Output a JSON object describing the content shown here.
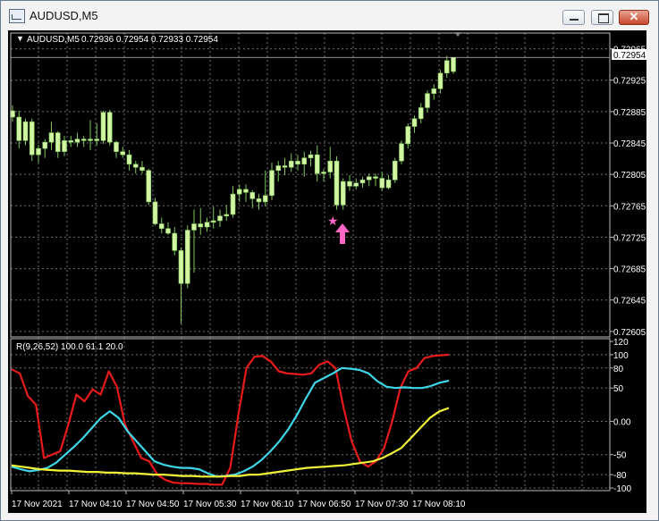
{
  "window": {
    "title": "AUDUSD,M5",
    "icon": "chart-window-icon",
    "buttons": {
      "minimize": "minimize-icon",
      "maximize": "maximize-icon",
      "close": "close-icon",
      "close_glyph": "✕"
    }
  },
  "chart_header": {
    "arrow": "▼",
    "symbol": "AUDUSD,M5",
    "ohlc": "0.72936 0.72954 0.72933 0.72954"
  },
  "price_axis": {
    "ticks": [
      "0.72965",
      "0.72925",
      "0.72885",
      "0.72845",
      "0.72805",
      "0.72765",
      "0.72725",
      "0.72685",
      "0.72645",
      "0.72605"
    ],
    "current_price": "0.72954"
  },
  "indicator": {
    "label": "R(9,26,52) 100.0 61.1 20.0",
    "ticks": [
      "120",
      "100",
      "80",
      "50",
      "0.00",
      "-50",
      "-80",
      "-100"
    ]
  },
  "time_axis": {
    "ticks": [
      "17 Nov 2021",
      "17 Nov 04:10",
      "17 Nov 04:50",
      "17 Nov 05:30",
      "17 Nov 06:10",
      "17 Nov 06:50",
      "17 Nov 07:30",
      "17 Nov 08:10"
    ]
  },
  "signal": {
    "star": "★",
    "arrow": "up-arrow-signal-icon"
  },
  "colors": {
    "background": "#000000",
    "grid": "#6f6f6f",
    "candle_body": "#d2f5a4",
    "candle_wick": "#7fc65a",
    "price_line": "#c0c0c0",
    "signal": "#ff66c4",
    "line_red": "#e81a1a",
    "line_cyan": "#3fd6e8",
    "line_yellow": "#f2f23a",
    "text": "#ffffff"
  },
  "chart_data": [
    {
      "type": "candlestick",
      "symbol": "AUDUSD,M5",
      "ylim": [
        0.72598,
        0.72985
      ],
      "candles": [
        [
          0.72886,
          0.72893,
          0.72872,
          0.72878
        ],
        [
          0.72878,
          0.72886,
          0.72838,
          0.72848
        ],
        [
          0.72848,
          0.72876,
          0.72842,
          0.72872
        ],
        [
          0.72872,
          0.72876,
          0.72822,
          0.7283
        ],
        [
          0.7283,
          0.72842,
          0.7282,
          0.72838
        ],
        [
          0.72838,
          0.7285,
          0.72826,
          0.72846
        ],
        [
          0.72846,
          0.72872,
          0.72836,
          0.72858
        ],
        [
          0.72858,
          0.7286,
          0.72826,
          0.72834
        ],
        [
          0.72834,
          0.72854,
          0.72828,
          0.72848
        ],
        [
          0.72848,
          0.72854,
          0.7284,
          0.72846
        ],
        [
          0.72846,
          0.72858,
          0.7284,
          0.7285
        ],
        [
          0.7285,
          0.72854,
          0.7284,
          0.72848
        ],
        [
          0.72848,
          0.72874,
          0.72836,
          0.7285
        ],
        [
          0.7285,
          0.7287,
          0.72842,
          0.72848
        ],
        [
          0.72848,
          0.72886,
          0.72844,
          0.72884
        ],
        [
          0.72884,
          0.72887,
          0.72842,
          0.72846
        ],
        [
          0.72846,
          0.72848,
          0.72826,
          0.72834
        ],
        [
          0.72834,
          0.7284,
          0.72826,
          0.7283
        ],
        [
          0.7283,
          0.72836,
          0.7281,
          0.72818
        ],
        [
          0.72818,
          0.72822,
          0.72806,
          0.72814
        ],
        [
          0.72814,
          0.72822,
          0.72806,
          0.7281
        ],
        [
          0.7281,
          0.72812,
          0.72766,
          0.7277
        ],
        [
          0.7277,
          0.72775,
          0.7274,
          0.72742
        ],
        [
          0.72742,
          0.7275,
          0.7273,
          0.72736
        ],
        [
          0.72736,
          0.72744,
          0.72728,
          0.7273
        ],
        [
          0.7273,
          0.72738,
          0.72702,
          0.72708
        ],
        [
          0.72708,
          0.72712,
          0.72615,
          0.72666
        ],
        [
          0.72666,
          0.7274,
          0.7266,
          0.72734
        ],
        [
          0.72734,
          0.7276,
          0.7268,
          0.72742
        ],
        [
          0.72742,
          0.72762,
          0.72728,
          0.72738
        ],
        [
          0.72738,
          0.7275,
          0.72732,
          0.72744
        ],
        [
          0.72744,
          0.72764,
          0.72736,
          0.72746
        ],
        [
          0.72746,
          0.7276,
          0.72738,
          0.72752
        ],
        [
          0.72752,
          0.72766,
          0.72746,
          0.72754
        ],
        [
          0.72754,
          0.7279,
          0.7275,
          0.7278
        ],
        [
          0.7278,
          0.72792,
          0.7277,
          0.72786
        ],
        [
          0.72786,
          0.72792,
          0.7277,
          0.72782
        ],
        [
          0.72782,
          0.72785,
          0.72762,
          0.72774
        ],
        [
          0.72774,
          0.7278,
          0.7276,
          0.7277
        ],
        [
          0.7277,
          0.7281,
          0.72764,
          0.72778
        ],
        [
          0.72778,
          0.7282,
          0.72772,
          0.7281
        ],
        [
          0.7281,
          0.72822,
          0.72796,
          0.72816
        ],
        [
          0.72816,
          0.72826,
          0.72804,
          0.72814
        ],
        [
          0.72814,
          0.72832,
          0.72808,
          0.72822
        ],
        [
          0.72822,
          0.7283,
          0.7281,
          0.72818
        ],
        [
          0.72818,
          0.72834,
          0.72802,
          0.72826
        ],
        [
          0.72826,
          0.72835,
          0.72815,
          0.7283
        ],
        [
          0.7283,
          0.72842,
          0.72796,
          0.72806
        ],
        [
          0.72806,
          0.72812,
          0.72796,
          0.72808
        ],
        [
          0.72808,
          0.7284,
          0.728,
          0.72822
        ],
        [
          0.72822,
          0.72828,
          0.7276,
          0.72766
        ],
        [
          0.72766,
          0.728,
          0.7276,
          0.72796
        ],
        [
          0.72796,
          0.72804,
          0.72784,
          0.7279
        ],
        [
          0.7279,
          0.728,
          0.72786,
          0.72794
        ],
        [
          0.72794,
          0.72802,
          0.72788,
          0.72798
        ],
        [
          0.72798,
          0.72806,
          0.7279,
          0.72802
        ],
        [
          0.72802,
          0.72806,
          0.7279,
          0.728
        ],
        [
          0.728,
          0.72808,
          0.72784,
          0.72788
        ],
        [
          0.72788,
          0.72804,
          0.72786,
          0.72798
        ],
        [
          0.72798,
          0.72826,
          0.72794,
          0.72822
        ],
        [
          0.72822,
          0.72848,
          0.72818,
          0.72844
        ],
        [
          0.72844,
          0.7287,
          0.72838,
          0.72866
        ],
        [
          0.72866,
          0.7288,
          0.72858,
          0.72876
        ],
        [
          0.72876,
          0.72896,
          0.7287,
          0.7289
        ],
        [
          0.7289,
          0.72912,
          0.72884,
          0.72908
        ],
        [
          0.72908,
          0.7292,
          0.729,
          0.72914
        ],
        [
          0.72914,
          0.72938,
          0.72908,
          0.72934
        ],
        [
          0.72934,
          0.72956,
          0.72928,
          0.7295
        ],
        [
          0.72936,
          0.72954,
          0.72933,
          0.72954
        ]
      ]
    },
    {
      "type": "line",
      "title": "R(9,26,52) 100.0 61.1 20.0",
      "ylim": [
        -104,
        124
      ],
      "series_count": 3,
      "x": [
        0,
        2,
        4,
        6,
        8,
        10,
        12,
        14,
        16,
        18,
        20,
        22,
        24,
        26,
        28,
        30,
        32,
        34,
        36,
        38,
        40,
        42,
        44,
        46,
        48,
        50,
        52,
        54,
        56,
        58,
        60,
        62,
        64,
        66,
        68
      ],
      "series": [
        {
          "values": [
            78,
            72,
            38,
            25,
            -55,
            -50,
            -45,
            -5,
            40,
            30,
            48,
            40,
            75,
            52,
            -5,
            -30,
            -55,
            -60,
            -80,
            -88,
            -92,
            -93,
            -93,
            -94,
            -94,
            -95,
            -95,
            -70,
            10,
            80,
            97,
            98,
            90,
            75,
            72,
            71,
            70,
            72,
            85,
            90,
            80,
            20,
            -30,
            -60,
            -68,
            -60,
            -40,
            0,
            50,
            75,
            80,
            95,
            98,
            99,
            100
          ]
        },
        {
          "values": [
            -68,
            -72,
            -75,
            -73,
            -70,
            -62,
            -50,
            -38,
            -25,
            -10,
            5,
            15,
            5,
            -15,
            -30,
            -45,
            -60,
            -65,
            -68,
            -70,
            -70,
            -72,
            -78,
            -83,
            -82,
            -80,
            -75,
            -68,
            -58,
            -45,
            -30,
            -12,
            10,
            35,
            58,
            65,
            72,
            80,
            79,
            77,
            72,
            60,
            52,
            50,
            51,
            50,
            50,
            53,
            58,
            61
          ]
        },
        {
          "values": [
            -66,
            -68,
            -70,
            -72,
            -73,
            -74,
            -74,
            -75,
            -76,
            -76,
            -77,
            -77,
            -78,
            -78,
            -79,
            -80,
            -80,
            -81,
            -82,
            -82,
            -83,
            -83,
            -83,
            -82,
            -82,
            -80,
            -80,
            -78,
            -76,
            -74,
            -72,
            -70,
            -69,
            -68,
            -67,
            -66,
            -64,
            -62,
            -60,
            -55,
            -48,
            -40,
            -25,
            -10,
            5,
            15,
            20
          ]
        }
      ]
    }
  ]
}
